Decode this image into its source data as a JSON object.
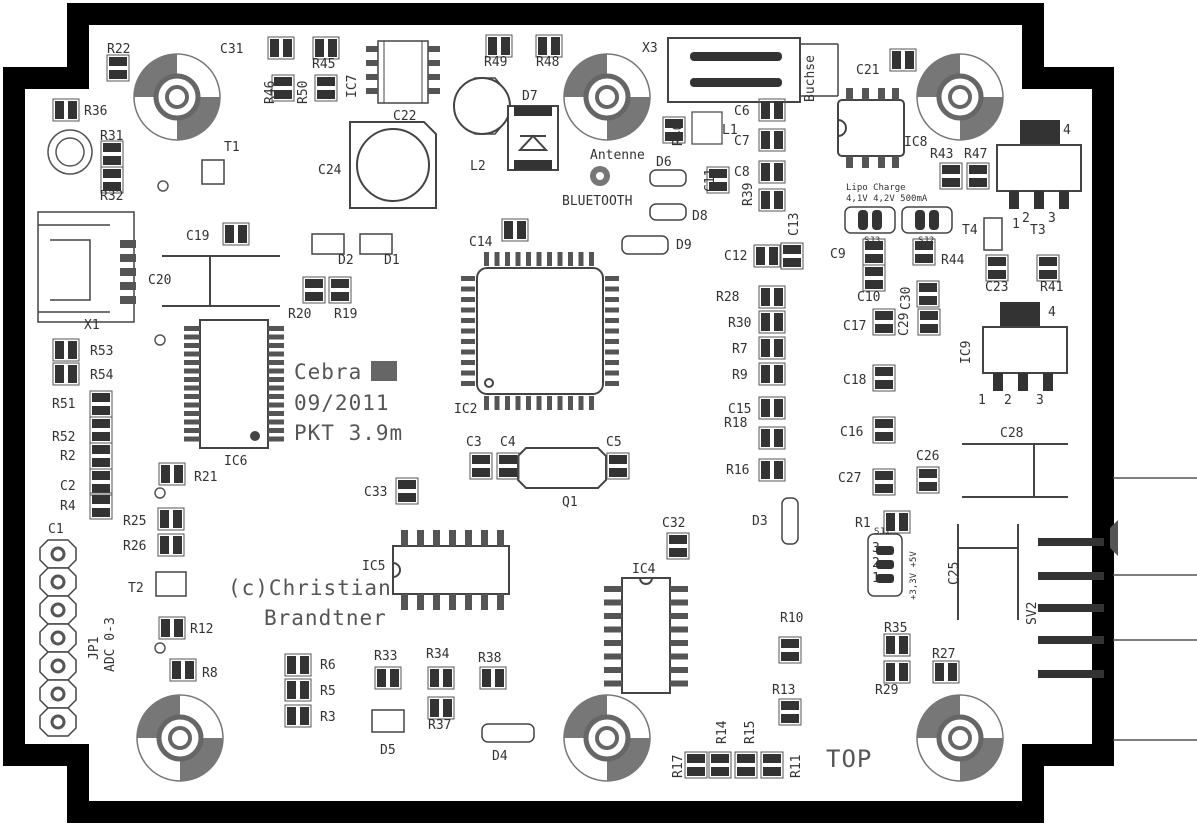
{
  "title_lines": [
    "Cebra",
    "09/2011",
    "PKT 3.9m"
  ],
  "author_lines": [
    "(c)Christian",
    "Brandtner"
  ],
  "side_label": "TOP",
  "antenna": [
    "Antenne",
    "BLUETOOTH"
  ],
  "lipo": [
    "Lipo Charge",
    "4,1V 4,2V 500mA"
  ],
  "sj_labels": [
    "SJ3",
    "SJ2",
    "SJ1"
  ],
  "voltage_label": "+3,3V +5V",
  "jp1_label": [
    "JP1",
    "ADC 0-3"
  ],
  "buchse_label": "Buchse",
  "ic_labels": [
    "IC2",
    "IC4",
    "IC5",
    "IC6",
    "IC7",
    "IC8",
    "IC9"
  ],
  "connector_labels": [
    "X1",
    "X3",
    "SV2",
    "Q1",
    "L1",
    "L2"
  ],
  "transistor_labels": [
    "T1",
    "T2",
    "T3",
    "T4"
  ],
  "diode_labels": [
    "D1",
    "D2",
    "D3",
    "D4",
    "D5",
    "D6",
    "D7",
    "D8",
    "D9"
  ],
  "capacitor_labels": [
    "C1",
    "C2",
    "C3",
    "C4",
    "C5",
    "C6",
    "C7",
    "C8",
    "C9",
    "C10",
    "C11",
    "C12",
    "C13",
    "C14",
    "C15",
    "C16",
    "C17",
    "C18",
    "C19",
    "C20",
    "C21",
    "C22",
    "C23",
    "C24",
    "C25",
    "C26",
    "C27",
    "C28",
    "C29",
    "C30",
    "C31",
    "C32",
    "C33"
  ],
  "resistor_labels": [
    "R1",
    "R2",
    "R4",
    "R5",
    "R6",
    "R7",
    "R8",
    "R9",
    "R10",
    "R11",
    "R12",
    "R13",
    "R14",
    "R15",
    "R16",
    "R17",
    "R18",
    "R19",
    "R20",
    "R21",
    "R22",
    "R25",
    "R26",
    "R27",
    "R28",
    "R29",
    "R30",
    "R31",
    "R32",
    "R33",
    "R34",
    "R35",
    "R36",
    "R37",
    "R38",
    "R39",
    "R40",
    "R41",
    "R43",
    "R44",
    "R45",
    "R46",
    "R47",
    "R48",
    "R49",
    "R50",
    "R51",
    "R52",
    "R53",
    "R54",
    "R3"
  ],
  "pin_numbers": [
    "1",
    "2",
    "3",
    "4"
  ],
  "colors": {
    "board": "#ffffff",
    "outline": "#000000",
    "silk": "#333333",
    "mount": "#777777"
  }
}
